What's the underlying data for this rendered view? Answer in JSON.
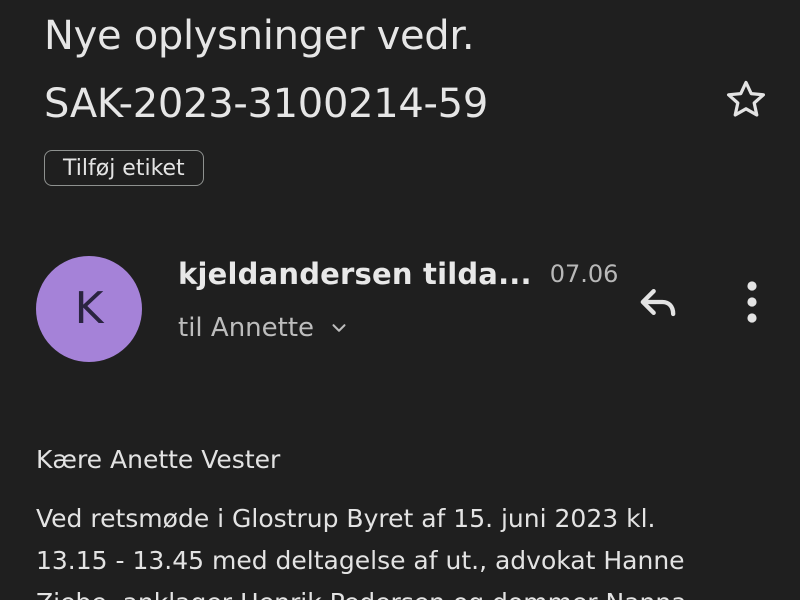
{
  "email": {
    "subject_lines": [
      "Nye oplysninger vedr.",
      "SAK-2023-3100214-59"
    ],
    "label_button": "Tilføj etiket",
    "sender": {
      "avatar_letter": "K",
      "avatar_color": "#a582d8",
      "name": "kjeldandersen tilda...",
      "time": "07.06",
      "recipient": "til Annette"
    },
    "body": {
      "greeting": "Kære Anette Vester",
      "paragraph_lines": [
        "Ved retsmøde i Glostrup Byret af 15. juni 2023 kl.",
        "13.15 - 13.45 med deltagelse af ut., advokat Hanne",
        "Ziebe, anklager Henrik Pedersen og dommer Nanna"
      ]
    }
  },
  "icons": {
    "star": "star-outline-icon",
    "reply": "reply-icon",
    "more": "more-vert-icon",
    "chevron": "chevron-down-icon"
  },
  "colors": {
    "background": "#1f1f1f",
    "text": "#e3e3e3",
    "avatar": "#a582d8"
  }
}
